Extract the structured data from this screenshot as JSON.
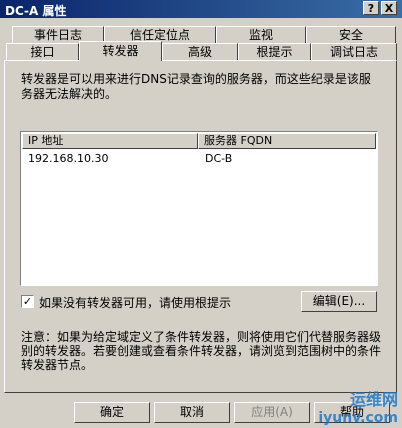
{
  "window": {
    "title": "DC-A 属性",
    "help_btn": "?",
    "close_btn": "X"
  },
  "tabs": {
    "row_top": [
      "事件日志",
      "信任定位点",
      "监视",
      "安全"
    ],
    "row_bottom": [
      "接口",
      "转发器",
      "高级",
      "根提示",
      "调试日志"
    ],
    "active": "转发器"
  },
  "forwarders": {
    "description": "转发器是可以用来进行DNS记录查询的服务器，而这些纪录是该服务器无法解决的。",
    "columns": [
      "IP 地址",
      "服务器 FQDN"
    ],
    "rows": [
      {
        "ip": "192.168.10.30",
        "fqdn": "DC-B"
      }
    ],
    "use_root_hints_checked": true,
    "check_mark": "✓",
    "use_root_hints_label": "如果没有转发器可用，请使用根提示",
    "edit_button": "编辑(E)...",
    "note": "注意：如果为给定域定义了条件转发器，则将使用它们代替服务器级别的转发器。若要创建或查看条件转发器，请浏览到范围树中的条件转发器节点。"
  },
  "footer": {
    "ok": "确定",
    "cancel": "取消",
    "apply": "应用(A)",
    "help": "帮助"
  },
  "watermark": {
    "line1": "运维网",
    "line2": "iyunv.com"
  }
}
